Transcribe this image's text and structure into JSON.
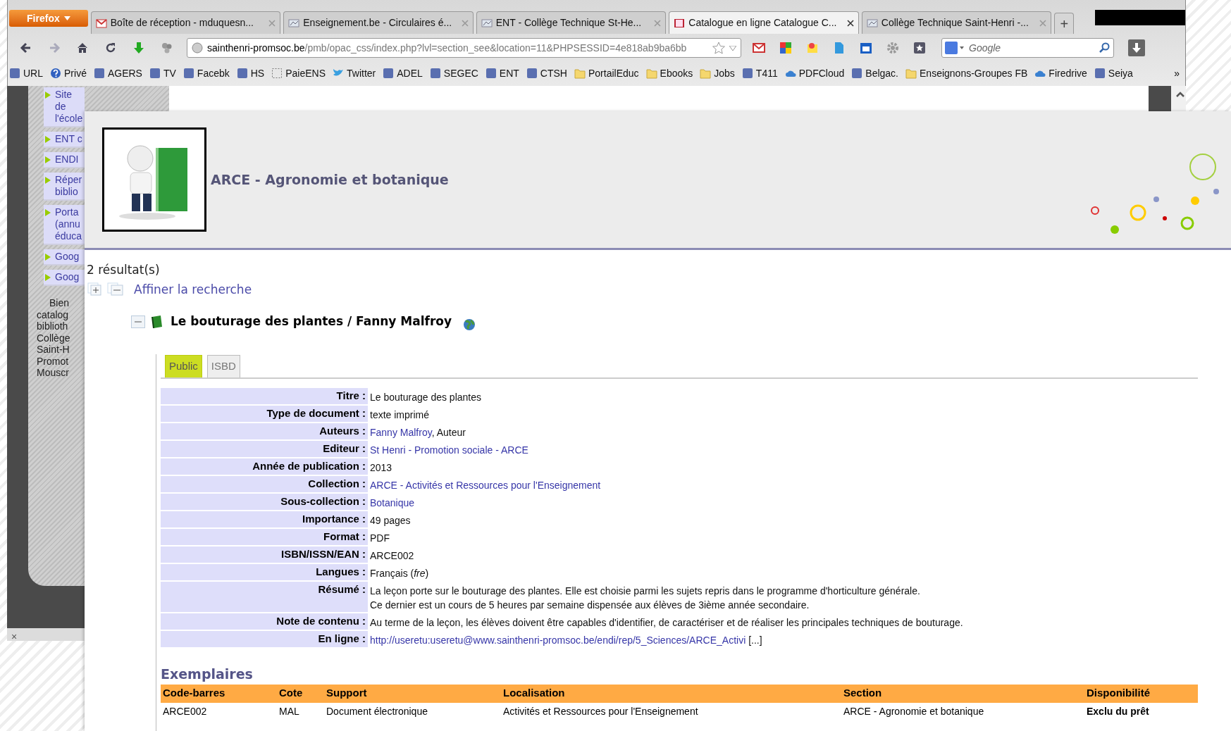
{
  "browser": {
    "menu_button": "Firefox",
    "tabs": [
      {
        "title": "Boîte de réception - mduquesn...",
        "selected": false
      },
      {
        "title": "Enseignement.be - Circulaires é...",
        "selected": false
      },
      {
        "title": "ENT - Collège Technique St-He...",
        "selected": false
      },
      {
        "title": "Catalogue en ligne Catalogue C...",
        "selected": true
      },
      {
        "title": "Collège Technique Saint-Henri -...",
        "selected": false
      }
    ],
    "new_tab": "+",
    "url_host": "sainthenri-promsoc.be",
    "url_path": "/pmb/opac_css/index.php?lvl=section_see&location=11&PHPSESSID=4e818ab9ba6bb",
    "search_placeholder": "Google",
    "bookmarks": [
      {
        "label": "URL",
        "kind": "site"
      },
      {
        "label": "Privé",
        "kind": "help"
      },
      {
        "label": "AGERS",
        "kind": "site"
      },
      {
        "label": "TV",
        "kind": "site"
      },
      {
        "label": "Facebk",
        "kind": "site"
      },
      {
        "label": "HS",
        "kind": "site"
      },
      {
        "label": "PaieENS",
        "kind": "dashed"
      },
      {
        "label": "Twitter",
        "kind": "bird"
      },
      {
        "label": "ADEL",
        "kind": "site"
      },
      {
        "label": "SEGEC",
        "kind": "site"
      },
      {
        "label": "ENT",
        "kind": "site"
      },
      {
        "label": "CTSH",
        "kind": "site"
      },
      {
        "label": "PortailEduc",
        "kind": "folder"
      },
      {
        "label": "Ebooks",
        "kind": "folder"
      },
      {
        "label": "Jobs",
        "kind": "folder"
      },
      {
        "label": "T411",
        "kind": "site"
      },
      {
        "label": "PDFCloud",
        "kind": "cloud"
      },
      {
        "label": "Belgac.",
        "kind": "site"
      },
      {
        "label": "Enseignons-Groupes FB",
        "kind": "folder"
      },
      {
        "label": "Firedrive",
        "kind": "cloud"
      },
      {
        "label": "Seiya",
        "kind": "site"
      }
    ],
    "more": "»"
  },
  "sidebar": {
    "items": [
      {
        "lines": [
          "Site de l'école"
        ]
      },
      {
        "lines": [
          "ENT c"
        ]
      },
      {
        "lines": [
          "ENDI"
        ]
      },
      {
        "lines": [
          "Réper",
          "biblio"
        ]
      },
      {
        "lines": [
          "Porta",
          "(annu",
          "éduca"
        ]
      },
      {
        "lines": [
          "Goog"
        ]
      },
      {
        "lines": [
          "Goog"
        ]
      }
    ],
    "welcome_lines": [
      "Bien",
      "catalog",
      "biblioth",
      "Collège",
      "Saint-H",
      "Promot",
      "Mouscr"
    ],
    "close": "×"
  },
  "catalog": {
    "section_title": "ARCE - Agronomie et botanique",
    "results": "2 résultat(s)",
    "refine": "Affiner la recherche",
    "record_title": "Le bouturage des plantes / Fanny Malfroy",
    "tabs": [
      {
        "label": "Public",
        "selected": true
      },
      {
        "label": "ISBD",
        "selected": false
      }
    ],
    "fields": [
      {
        "label": "Titre :",
        "lines": [
          [
            {
              "text": "Le bouturage des plantes",
              "link": false
            }
          ]
        ]
      },
      {
        "label": "Type de document :",
        "lines": [
          [
            {
              "text": "texte imprimé",
              "link": false
            }
          ]
        ]
      },
      {
        "label": "Auteurs :",
        "lines": [
          [
            {
              "text": "Fanny Malfroy",
              "link": true
            },
            {
              "text": ", Auteur",
              "link": false
            }
          ]
        ]
      },
      {
        "label": "Editeur :",
        "lines": [
          [
            {
              "text": "St Henri - Promotion sociale - ARCE",
              "link": true
            }
          ]
        ]
      },
      {
        "label": "Année de publication :",
        "lines": [
          [
            {
              "text": "2013",
              "link": false
            }
          ]
        ]
      },
      {
        "label": "Collection :",
        "lines": [
          [
            {
              "text": "ARCE - Activités et Ressources pour l'Enseignement",
              "link": true
            }
          ]
        ]
      },
      {
        "label": "Sous-collection :",
        "lines": [
          [
            {
              "text": "Botanique",
              "link": true
            }
          ]
        ]
      },
      {
        "label": "Importance :",
        "lines": [
          [
            {
              "text": "49 pages",
              "link": false
            }
          ]
        ]
      },
      {
        "label": "Format :",
        "lines": [
          [
            {
              "text": "PDF",
              "link": false
            }
          ]
        ]
      },
      {
        "label": "ISBN/ISSN/EAN :",
        "lines": [
          [
            {
              "text": "ARCE002",
              "link": false
            }
          ]
        ]
      },
      {
        "label": "Langues :",
        "lines": [
          [
            {
              "text": "Français (*fre*)",
              "link": false
            }
          ]
        ]
      },
      {
        "label": "Résumé :",
        "lines": [
          [
            {
              "text": "La leçon porte sur le bouturage des plantes. Elle est choisie parmi les sujets repris dans le programme d'horticulture générale.",
              "link": false
            }
          ],
          [
            {
              "text": "Ce dernier est un cours de 5 heures par semaine dispensée aux élèves de 3ième année secondaire.",
              "link": false
            }
          ]
        ]
      },
      {
        "label": "Note de contenu :",
        "lines": [
          [
            {
              "text": "Au terme de la leçon, les élèves doivent être capables d'identifier, de caractériser et de réaliser les principales techniques de bouturage.",
              "link": false
            }
          ]
        ]
      },
      {
        "label": "En ligne :",
        "lines": [
          [
            {
              "text": "http://useretu:useretu@www.sainthenri-promsoc.be/endi/rep/5_Sciences/ARCE_Activi",
              "link": true
            },
            {
              "text": " [...]",
              "link": false
            }
          ]
        ]
      }
    ],
    "copies": {
      "title": "Exemplaires",
      "columns": [
        "Code-barres",
        "Cote",
        "Support",
        "Localisation",
        "Section",
        "Disponibilité"
      ],
      "rows": [
        [
          "ARCE002",
          "MAL",
          "Document électronique",
          "Activités et Ressources pour l'Enseignement",
          "ARCE - Agronomie et botanique",
          "Exclu du prêt"
        ]
      ]
    }
  }
}
